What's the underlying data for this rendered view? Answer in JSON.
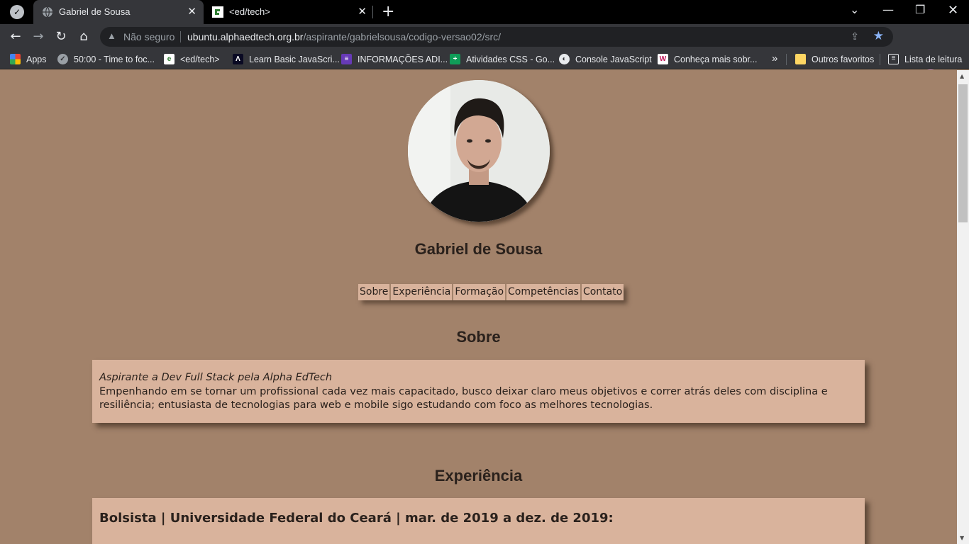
{
  "browser": {
    "tabs": [
      {
        "title": "Gabriel de Sousa",
        "active": true
      },
      {
        "title": "<ed/tech>",
        "active": false
      }
    ],
    "address": {
      "security_label": "Não seguro",
      "host": "ubuntu.alphaedtech.org.br",
      "path": "/aspirante/gabrielsousa/codigo-versao02/src/"
    },
    "bookmarks": [
      {
        "label": "Apps",
        "icon": "apps-grid-icon",
        "color": "#ea4335"
      },
      {
        "label": "50:00 - Time to foc...",
        "icon": "check-circle-icon",
        "color": "#9aa0a6"
      },
      {
        "label": "<ed/tech>",
        "icon": "edtech-icon",
        "color": "#ffffff"
      },
      {
        "label": "Learn Basic JavaScri...",
        "icon": "freecodecamp-icon",
        "color": "#0a0a23"
      },
      {
        "label": "INFORMAÇÕES ADI...",
        "icon": "forms-icon",
        "color": "#673ab7"
      },
      {
        "label": "Atividades CSS - Go...",
        "icon": "sheets-icon",
        "color": "#0f9d58"
      },
      {
        "label": "Console JavaScript",
        "icon": "globe-icon",
        "color": "#e8eaed"
      },
      {
        "label": "Conheça mais sobr...",
        "icon": "w-icon",
        "color": "#c2185b"
      }
    ],
    "other_bookmarks": "Outros favoritos",
    "reading_list": "Lista de leitura"
  },
  "page": {
    "name": "Gabriel de Sousa",
    "nav": [
      "Sobre",
      "Experiência",
      "Formação",
      "Competências",
      "Contato"
    ],
    "sobre": {
      "title": "Sobre",
      "role": "Aspirante a Dev Full Stack pela Alpha EdTech",
      "text": "Empenhando em se tornar um profissional cada vez mais capacitado, busco deixar claro meus objetivos e correr atrás deles com disciplina e resiliência; entusiasta de tecnologias para web e mobile sigo estudando com foco as melhores tecnologias."
    },
    "experiencia": {
      "title": "Experiência",
      "item": "Bolsista | Universidade Federal do Ceará | mar. de 2019 a dez. de 2019:"
    }
  }
}
